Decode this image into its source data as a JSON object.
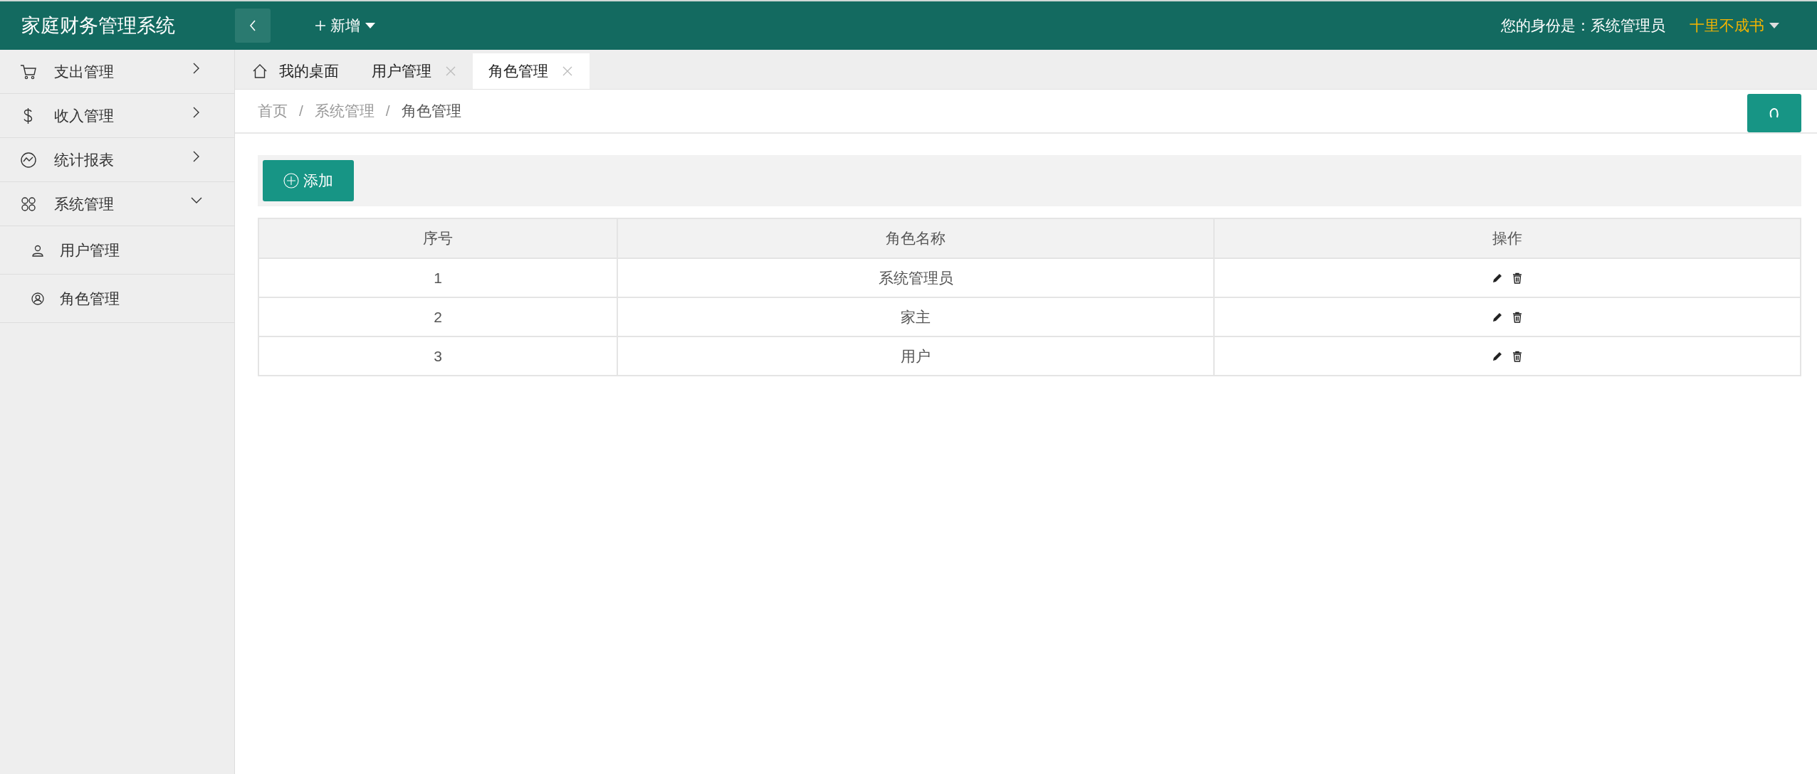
{
  "header": {
    "title": "家庭财务管理系统",
    "new_menu": "新增",
    "role_text": "您的身份是：系统管理员",
    "user_name": "十里不成书"
  },
  "sidebar": {
    "items": [
      {
        "label": "支出管理",
        "expanded": false
      },
      {
        "label": "收入管理",
        "expanded": false
      },
      {
        "label": "统计报表",
        "expanded": false
      },
      {
        "label": "系统管理",
        "expanded": true,
        "children": [
          {
            "label": "用户管理"
          },
          {
            "label": "角色管理"
          }
        ]
      }
    ]
  },
  "tabs": [
    {
      "label": "我的桌面",
      "selected": false,
      "closable": false
    },
    {
      "label": "用户管理",
      "selected": false,
      "closable": true
    },
    {
      "label": "角色管理",
      "selected": true,
      "closable": true
    }
  ],
  "breadcrumb": [
    {
      "kind": "link",
      "label": "首页"
    },
    {
      "kind": "separator",
      "label": "/"
    },
    {
      "kind": "link",
      "label": "系统管理"
    },
    {
      "kind": "separator",
      "label": "/"
    },
    {
      "kind": "current",
      "label": "角色管理"
    }
  ],
  "toolbar": {
    "add_button": "添加"
  },
  "table": {
    "columns": [
      "序号",
      "角色名称",
      "操作"
    ],
    "rows": [
      {
        "index": "1",
        "name": "系统管理员"
      },
      {
        "index": "2",
        "name": "家主"
      },
      {
        "index": "3",
        "name": "用户"
      }
    ]
  }
}
